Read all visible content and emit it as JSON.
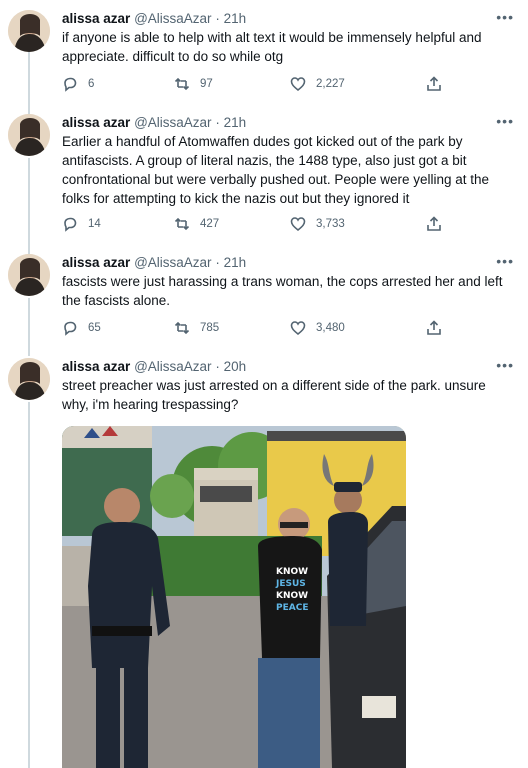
{
  "tweets": [
    {
      "name": "alissa azar",
      "handle": "@AlissaAzar",
      "time": "21h",
      "text": "if anyone is able to help with alt text it would be immensely helpful and appreciate. difficult to do so while otg",
      "replies": "6",
      "retweets": "97",
      "likes": "2,227"
    },
    {
      "name": "alissa azar",
      "handle": "@AlissaAzar",
      "time": "21h",
      "text": "Earlier a handful of Atomwaffen dudes got kicked out of the park by antifascists. A group of literal nazis, the 1488 type, also just got a bit confrontational but were verbally pushed out. People were yelling at the folks for attempting to kick the nazis out but they ignored it",
      "replies": "14",
      "retweets": "427",
      "likes": "3,733"
    },
    {
      "name": "alissa azar",
      "handle": "@AlissaAzar",
      "time": "21h",
      "text": "fascists were just harassing a trans woman, the cops arrested her and left the fascists alone.",
      "replies": "65",
      "retweets": "785",
      "likes": "3,480"
    },
    {
      "name": "alissa azar",
      "handle": "@AlissaAzar",
      "time": "20h",
      "text": "street preacher was just arrested on a different side of the park. unsure why, i'm hearing trespassing?"
    }
  ],
  "photo": {
    "shirt_lines": [
      "KNOW",
      "JESUS",
      "KNOW",
      "PEACE"
    ]
  },
  "separator": "·",
  "more": "•••"
}
